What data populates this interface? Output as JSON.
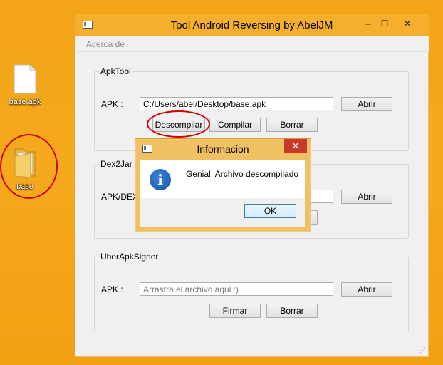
{
  "desktop": {
    "icons": [
      {
        "label": "base.apk",
        "icon": "file-icon"
      },
      {
        "label": "base",
        "icon": "folder-icon"
      }
    ]
  },
  "window": {
    "title": "Tool Android Reversing by AbelJM",
    "controls": {
      "minimize": "–",
      "maximize": "☐",
      "close": "✕"
    },
    "menu": {
      "about": "Acerca de"
    },
    "apktool": {
      "group_title": "ApkTool",
      "apk_label": "APK :",
      "apk_value": "C:/Users/abel/Desktop/base.apk",
      "open_label": "Abrir",
      "decompile_label": "Descompilar",
      "compile_label": "Compilar",
      "clear_label": "Borrar"
    },
    "dex2jar": {
      "group_title": "Dex2Jar",
      "apk_label": "APK/DEX :",
      "open_label": "Abrir"
    },
    "uber": {
      "group_title": "UberApkSigner",
      "apk_label": "APK :",
      "apk_placeholder": "Arrastra el archivo aqui :)",
      "open_label": "Abrir",
      "sign_label": "Firmar",
      "clear_label": "Borrar"
    }
  },
  "dialog": {
    "title": "Informacion",
    "close": "✕",
    "message": "Genial, Archivo descompilado",
    "ok_label": "OK",
    "icon": "info-icon"
  },
  "colors": {
    "desktop": "#f4a417",
    "titlebar": "#f6ae2d",
    "annotation": "#d00000",
    "dialog_close": "#c73a2b"
  }
}
